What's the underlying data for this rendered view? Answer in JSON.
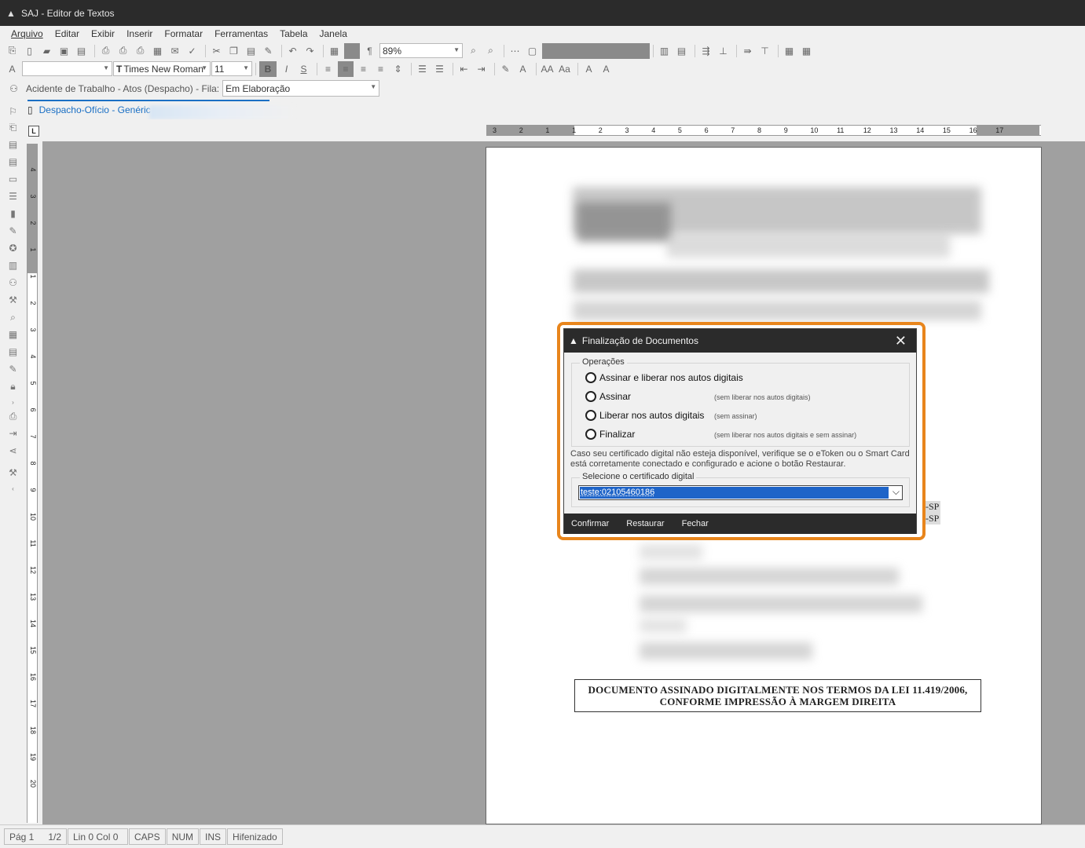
{
  "window": {
    "title": "SAJ - Editor de Textos"
  },
  "menu": [
    "Arquivo",
    "Editar",
    "Exibir",
    "Inserir",
    "Formatar",
    "Ferramentas",
    "Tabela",
    "Janela"
  ],
  "toolbar": {
    "zoom": "89%",
    "font_name": "Times New Roman",
    "font_size": "11",
    "style_value": ""
  },
  "fila_bar": {
    "label": "Acidente de Trabalho - Atos (Despacho) - Fila:",
    "fila_value": "Em Elaboração"
  },
  "tab": {
    "label": "Despacho-Ofício - Genéric"
  },
  "ruler": {
    "h_numbers": [
      "3",
      "2",
      "1",
      "1",
      "2",
      "3",
      "4",
      "5",
      "6",
      "7",
      "8",
      "9",
      "10",
      "11",
      "12",
      "13",
      "14",
      "15",
      "16",
      "17"
    ],
    "v_numbers": [
      "4",
      "3",
      "2",
      "1",
      "1",
      "2",
      "3",
      "4",
      "5",
      "6",
      "7",
      "8",
      "9",
      "10",
      "11",
      "12",
      "13",
      "14",
      "15",
      "16",
      "17",
      "18",
      "19",
      "20"
    ]
  },
  "document": {
    "signature_line1": "DOCUMENTO ASSINADO DIGITALMENTE NOS TERMOS DA LEI 11.419/2006,",
    "signature_line2": "CONFORME IMPRESSÃO À MARGEM DIREITA",
    "side_text_1": "-SP",
    "side_text_2": "-SP"
  },
  "dialog": {
    "title": "Finalização de Documentos",
    "operations_legend": "Operações",
    "options": [
      {
        "label": "Assinar e liberar nos autos digitais",
        "hint": ""
      },
      {
        "label": "Assinar",
        "hint": "(sem liberar nos autos digitais)"
      },
      {
        "label": "Liberar nos autos digitais",
        "hint": "(sem assinar)"
      },
      {
        "label": "Finalizar",
        "hint": "(sem liberar nos autos digitais e sem assinar)"
      }
    ],
    "info_text": "Caso seu certificado digital não esteja disponível, verifique se o eToken ou o Smart Card está corretamente conectado e configurado e acione o botão Restaurar.",
    "certificate_legend": "Selecione o certificado digital",
    "certificate_value": "teste:02105460186",
    "buttons": {
      "confirm": "Confirmar",
      "restore": "Restaurar",
      "close": "Fechar"
    }
  },
  "status": {
    "page": "Pág 1",
    "pages": "1/2",
    "position": "Lin 0  Col 0",
    "caps": "CAPS",
    "num": "NUM",
    "ins": "INS",
    "hyphen": "Hifenizado"
  },
  "colors": {
    "accent_frame": "#e8851c",
    "title_bar": "#2b2b2b",
    "tab_blue": "#1a6fc4",
    "selection": "#1e64c8"
  }
}
